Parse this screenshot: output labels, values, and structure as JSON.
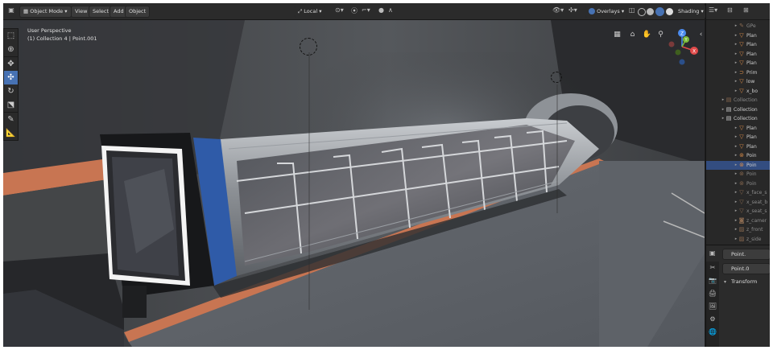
{
  "header": {
    "mode_label": "Object Mode",
    "menus": [
      "View",
      "Select",
      "Add",
      "Object"
    ],
    "orientation_label": "Local",
    "overlays_label": "Overlays",
    "shading_label": "Shading"
  },
  "viewport": {
    "view_name": "User Perspective",
    "context": "(1) Collection 4 | Point.001",
    "gizmo_labels": {
      "z": "Z",
      "x": "X",
      "y": "Y"
    }
  },
  "outliner": {
    "items": [
      {
        "label": "GPe",
        "icon": "grease-pencil-icon",
        "dim": true,
        "selected": false
      },
      {
        "label": "Plan",
        "icon": "mesh-icon",
        "dim": false,
        "selected": false
      },
      {
        "label": "Plan",
        "icon": "mesh-icon",
        "dim": false,
        "selected": false
      },
      {
        "label": "Plan",
        "icon": "mesh-icon",
        "dim": false,
        "selected": false
      },
      {
        "label": "Plan",
        "icon": "mesh-icon",
        "dim": false,
        "selected": false
      },
      {
        "label": "Prim",
        "icon": "curve-icon",
        "dim": false,
        "selected": false
      },
      {
        "label": "low",
        "icon": "mesh-icon",
        "dim": false,
        "selected": false
      },
      {
        "label": "x_bo",
        "icon": "mesh-icon",
        "dim": false,
        "selected": false
      },
      {
        "label": "Collection",
        "icon": "collection-icon",
        "dim": true,
        "selected": false
      },
      {
        "label": "Collection",
        "icon": "collection-icon",
        "dim": false,
        "selected": false
      },
      {
        "label": "Collection",
        "icon": "collection-icon",
        "dim": false,
        "selected": false
      },
      {
        "label": "Plan",
        "icon": "mesh-icon",
        "dim": false,
        "selected": false
      },
      {
        "label": "Plan",
        "icon": "mesh-icon",
        "dim": false,
        "selected": false
      },
      {
        "label": "Plan",
        "icon": "mesh-icon",
        "dim": false,
        "selected": false
      },
      {
        "label": "Poin",
        "icon": "light-icon",
        "dim": false,
        "selected": false
      },
      {
        "label": "Poin",
        "icon": "light-icon",
        "dim": false,
        "selected": true
      },
      {
        "label": "Poin",
        "icon": "light-icon",
        "dim": true,
        "selected": false
      },
      {
        "label": "Poin",
        "icon": "light-icon",
        "dim": true,
        "selected": false
      },
      {
        "label": "x_face_s",
        "icon": "mesh-icon",
        "dim": true,
        "selected": false
      },
      {
        "label": "x_seat_b",
        "icon": "mesh-icon",
        "dim": true,
        "selected": false
      },
      {
        "label": "x_seat_s",
        "icon": "mesh-icon",
        "dim": true,
        "selected": false
      },
      {
        "label": "z_camer",
        "icon": "camera-icon",
        "dim": true,
        "selected": false
      },
      {
        "label": "z_front",
        "icon": "image-icon",
        "dim": true,
        "selected": false
      },
      {
        "label": "z_side",
        "icon": "image-icon",
        "dim": true,
        "selected": false
      }
    ]
  },
  "properties": {
    "object_name": "Point.",
    "data_name": "Point.0",
    "panel_label": "Transform"
  },
  "colors": {
    "accent": "#4772b3",
    "selection": "#334d80",
    "orange_strip": "#c87552",
    "train_blue": "#2f5ba8",
    "light_frame": "#f4f4f4"
  }
}
